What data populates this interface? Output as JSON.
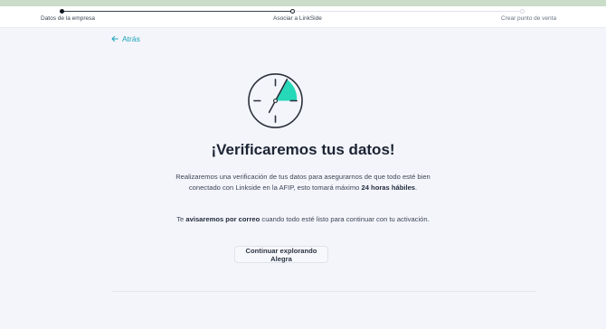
{
  "stepper": {
    "steps": [
      {
        "label": "Datos de la empresa",
        "state": "done"
      },
      {
        "label": "Asociar a LinkSide",
        "state": "current"
      },
      {
        "label": "Crear punto de venta",
        "state": "todo"
      }
    ]
  },
  "nav": {
    "back_label": "Atrás",
    "back_icon": "arrow-left-icon"
  },
  "illustration": {
    "icon": "clock-icon",
    "accent_color": "#26d7b8"
  },
  "content": {
    "title": "¡Verificaremos tus datos!",
    "p1_a": "Realizaremos una verificación de tus datos para asegurarnos de que todo esté bien conectado con Linkside en la AFIP, esto tomará máximo ",
    "p1_b": "24 horas hábiles",
    "p1_c": ".",
    "p2_a": "Te ",
    "p2_b": "avisaremos por correo",
    "p2_c": " cuando todo esté listo para continuar con tu activación."
  },
  "actions": {
    "continue_label": "Continuar explorando Alegra"
  },
  "colors": {
    "accent": "#18a2b8",
    "top_bar": "#c9ddc8",
    "background": "#f4f5fb"
  }
}
